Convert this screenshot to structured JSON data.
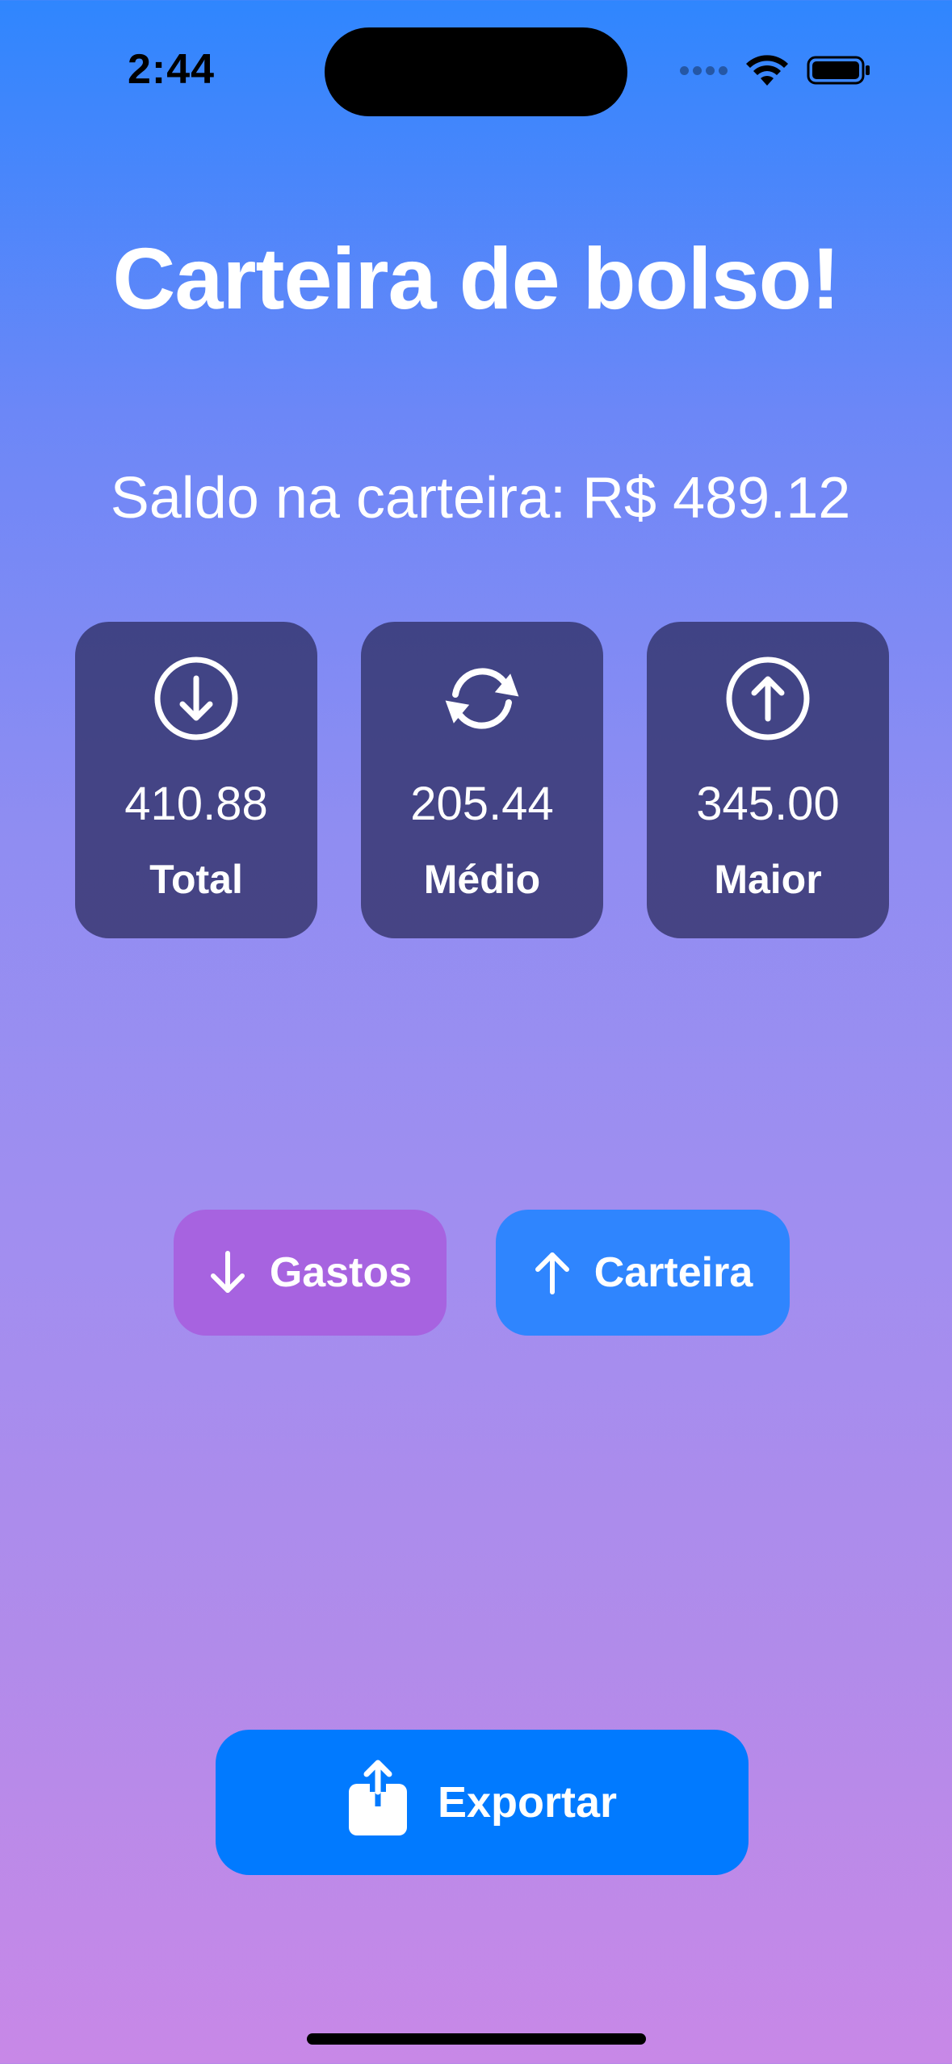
{
  "status_bar": {
    "time": "2:44"
  },
  "header": {
    "title": "Carteira de bolso!"
  },
  "balance": {
    "text": "Saldo na carteira: R$ 489.12"
  },
  "stats": [
    {
      "icon": "arrow-down-circle-icon",
      "value": "410.88",
      "label": "Total"
    },
    {
      "icon": "refresh-cycle-icon",
      "value": "205.44",
      "label": "Médio"
    },
    {
      "icon": "arrow-up-circle-icon",
      "value": "345.00",
      "label": "Maior"
    }
  ],
  "actions": {
    "gastos_label": "Gastos",
    "carteira_label": "Carteira",
    "export_label": "Exportar"
  },
  "colors": {
    "gradient_top": "#2f86fe",
    "gradient_bottom": "#c888e7",
    "card_bg": "#3a3f7a",
    "gastos_button": "#a763e0",
    "carteira_button": "#2f85fe",
    "export_button": "#017aff"
  }
}
